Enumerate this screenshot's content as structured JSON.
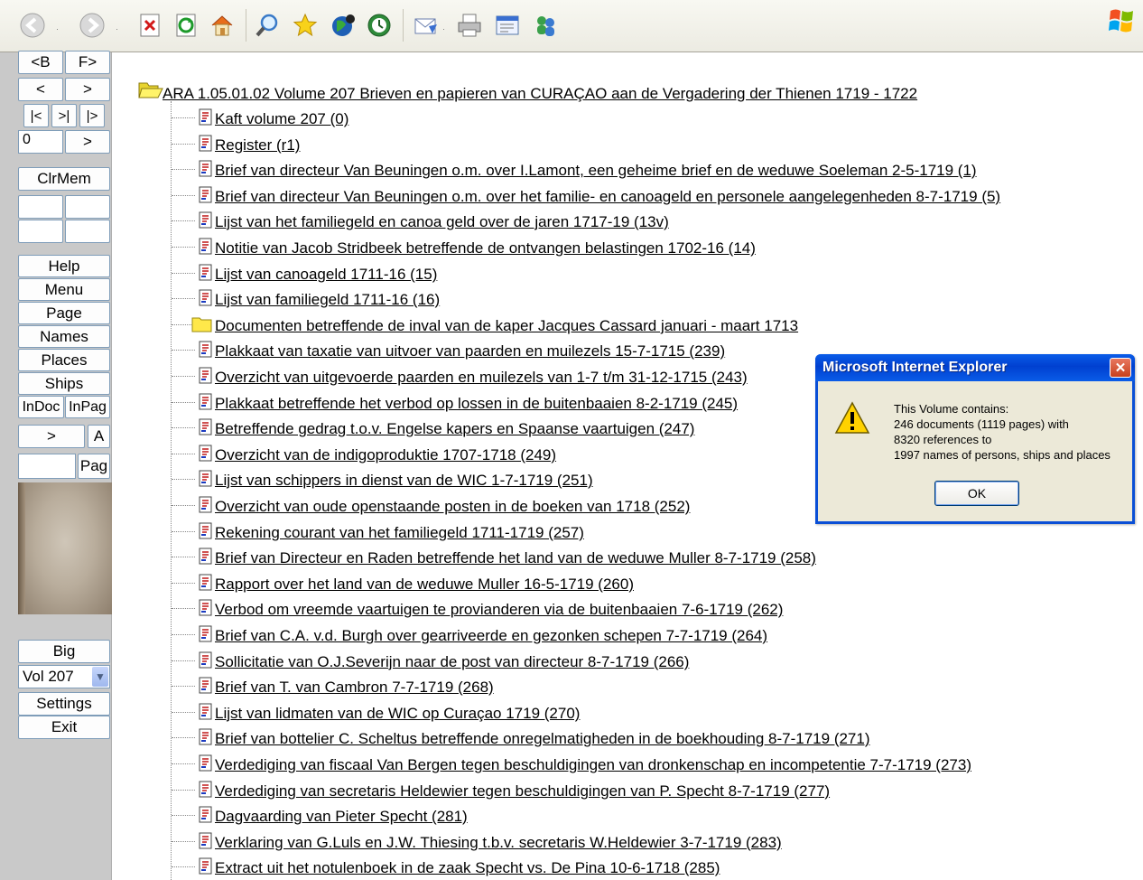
{
  "toolbar": {
    "buttons": [
      "back-icon",
      "forward-icon",
      "stop-icon",
      "refresh-icon",
      "home-icon",
      "search-icon",
      "favorites-icon",
      "media-icon",
      "history-icon",
      "mail-icon",
      "print-icon",
      "edit-icon",
      "messenger-icon"
    ]
  },
  "left": {
    "nav_back": "<B",
    "nav_fwd": "F>",
    "prev": "<",
    "next": ">",
    "first": "|<",
    "mid": ">|",
    "last": "|>",
    "page_input": "0",
    "go": ">",
    "clrmem": "ClrMem",
    "menu": [
      "Help",
      "Menu",
      "Page",
      "Names",
      "Places",
      "Ships"
    ],
    "indoc": "InDoc",
    "inpag": "InPag",
    "arrow": ">",
    "a": "A",
    "pag": "Pag",
    "big": "Big",
    "volume": "Vol 207",
    "settings": "Settings",
    "exit": "Exit"
  },
  "tree": {
    "root": "ARA 1.05.01.02 Volume 207 Brieven en papieren van CURAÇAO aan de Vergadering der Thienen 1719 - 1722",
    "items": [
      {
        "label": "Kaft volume 207 (0)",
        "type": "doc"
      },
      {
        "label": "Register (r1)",
        "type": "doc"
      },
      {
        "label": "Brief van directeur Van Beuningen o.m. over I.Lamont, een geheime brief en de weduwe Soeleman 2-5-1719 (1)",
        "type": "doc"
      },
      {
        "label": "Brief van directeur Van Beuningen o.m. over het familie- en canoageld en personele aangelegenheden 8-7-1719 (5)",
        "type": "doc"
      },
      {
        "label": "Lijst van het familiegeld en canoa geld over de jaren 1717-19 (13v)",
        "type": "doc"
      },
      {
        "label": "Notitie van Jacob Stridbeek betreffende de ontvangen belastingen 1702-16 (14)",
        "type": "doc"
      },
      {
        "label": "Lijst van canoageld 1711-16 (15)",
        "type": "doc"
      },
      {
        "label": "Lijst van familiegeld 1711-16 (16)",
        "type": "doc"
      },
      {
        "label": "Documenten betreffende de inval van de kaper Jacques Cassard januari - maart 1713",
        "type": "folder"
      },
      {
        "label": "Plakkaat van taxatie van uitvoer van paarden en muilezels 15-7-1715 (239)",
        "type": "doc"
      },
      {
        "label": "Overzicht van uitgevoerde paarden en muilezels van 1-7 t/m 31-12-1715 (243)",
        "type": "doc"
      },
      {
        "label": "Plakkaat betreffende het verbod op lossen in de buitenbaaien 8-2-1719 (245)",
        "type": "doc"
      },
      {
        "label": "Betreffende gedrag t.o.v. Engelse kapers en Spaanse vaartuigen (247)",
        "type": "doc"
      },
      {
        "label": "Overzicht van de indigoproduktie 1707-1718 (249)",
        "type": "doc"
      },
      {
        "label": "Lijst van schippers in dienst van de WIC 1-7-1719 (251)",
        "type": "doc"
      },
      {
        "label": "Overzicht van oude openstaande posten in de boeken van 1718 (252)",
        "type": "doc"
      },
      {
        "label": "Rekening courant van het familiegeld 1711-1719 (257)",
        "type": "doc"
      },
      {
        "label": "Brief van Directeur en Raden betreffende het land van de weduwe Muller 8-7-1719 (258)",
        "type": "doc"
      },
      {
        "label": "Rapport over het land van de weduwe Muller 16-5-1719 (260)",
        "type": "doc"
      },
      {
        "label": "Verbod om vreemde vaartuigen te provianderen via de buitenbaaien 7-6-1719 (262)",
        "type": "doc"
      },
      {
        "label": "Brief van C.A. v.d. Burgh over gearriveerde en gezonken schepen 7-7-1719 (264)",
        "type": "doc"
      },
      {
        "label": "Sollicitatie van O.J.Severijn naar de post van directeur 8-7-1719 (266)",
        "type": "doc"
      },
      {
        "label": "Brief van T. van Cambron 7-7-1719 (268)",
        "type": "doc"
      },
      {
        "label": "Lijst van lidmaten van de WIC op Curaçao 1719 (270)",
        "type": "doc"
      },
      {
        "label": "Brief van bottelier C. Scheltus betreffende onregelmatigheden in de boekhouding 8-7-1719 (271)",
        "type": "doc"
      },
      {
        "label": "Verdediging van fiscaal Van Bergen tegen beschuldigingen van dronkenschap en incompetentie 7-7-1719 (273)",
        "type": "doc"
      },
      {
        "label": "Verdediging van secretaris Heldewier tegen beschuldigingen van P. Specht 8-7-1719 (277)",
        "type": "doc"
      },
      {
        "label": "Dagvaarding van Pieter Specht (281)",
        "type": "doc"
      },
      {
        "label": "Verklaring van G.Luls en J.W. Thiesing t.b.v. secretaris W.Heldewier 3-7-1719 (283)",
        "type": "doc"
      },
      {
        "label": "Extract uit het notulenboek in de zaak Specht vs. De Pina 10-6-1718 (285)",
        "type": "doc"
      }
    ]
  },
  "dialog": {
    "title": "Microsoft Internet Explorer",
    "close": "✕",
    "line1": "This Volume contains:",
    "line2": "246 documents (1119 pages) with",
    "line3": "8320 references to",
    "line4": "1997 names of persons, ships and places",
    "ok": "OK"
  }
}
